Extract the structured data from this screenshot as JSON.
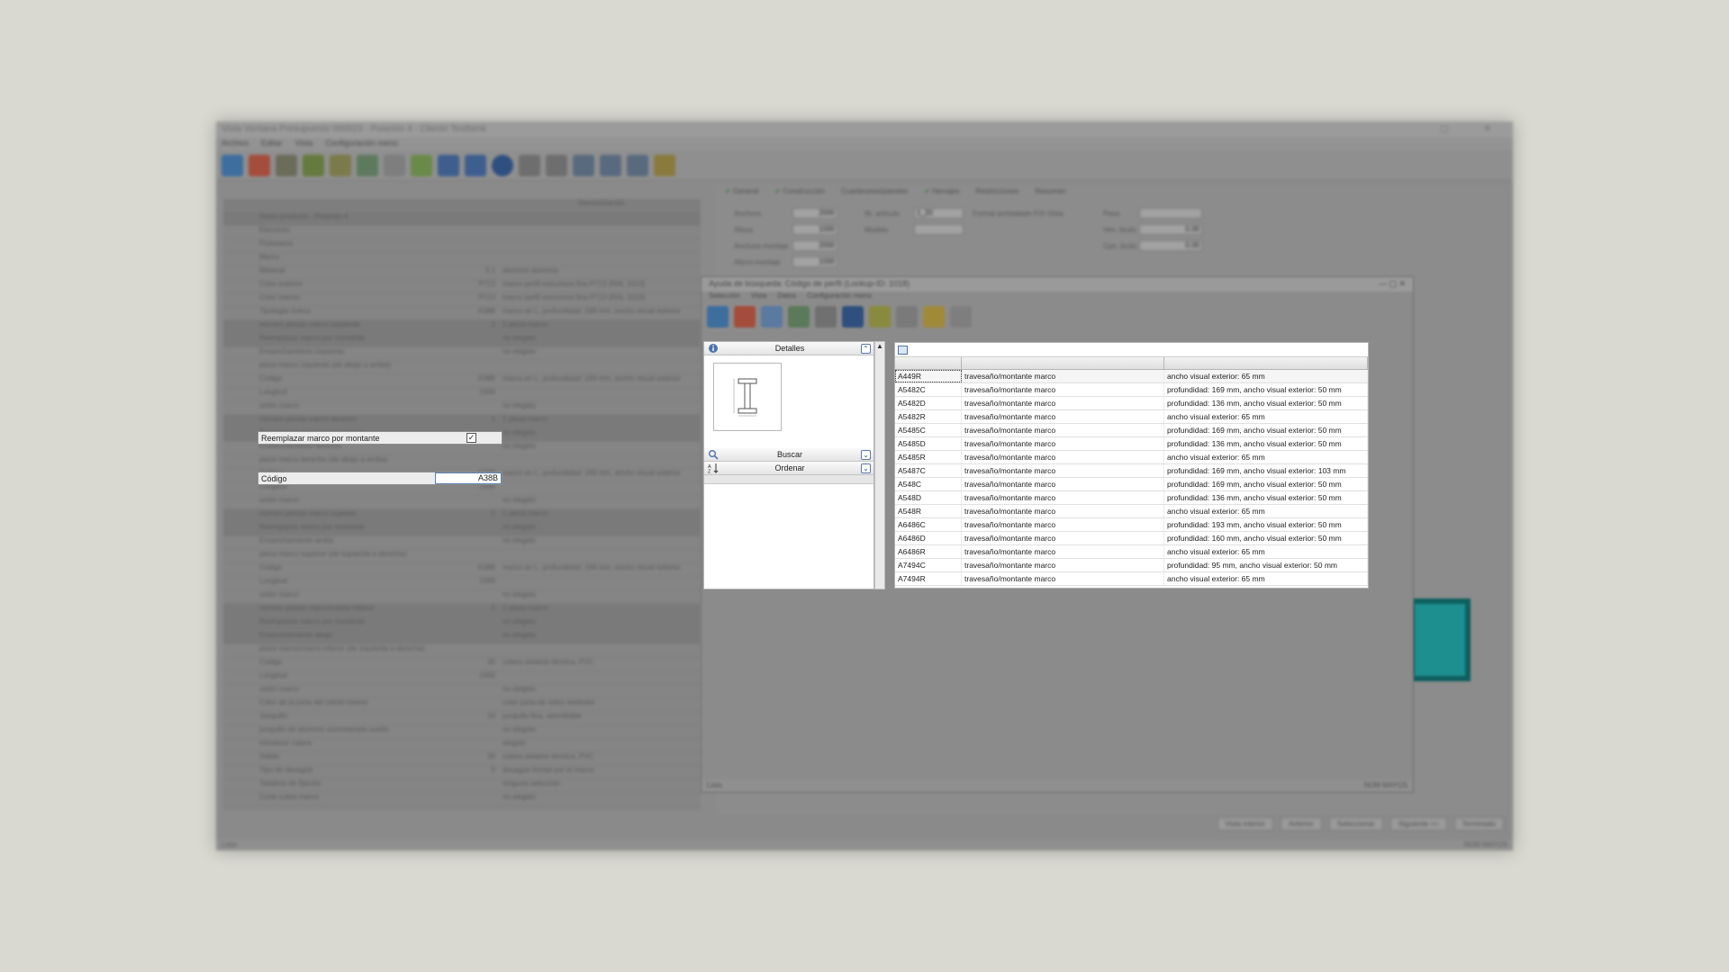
{
  "background_window": {
    "title": "Vista Ventana Presupuesto 000023 - Posición 4 - Cliente Testbenk",
    "window_controls": "▢ ✕",
    "menu": [
      "Archivo",
      "Editar",
      "Vista",
      "Configuración menú"
    ],
    "tree_rows": [
      {
        "label": "Datos producto - Posición 4",
        "value": "",
        "desc": "",
        "dark": true
      },
      {
        "label": "Elemento",
        "value": "",
        "desc": ""
      },
      {
        "label": "Postsasno",
        "value": "",
        "desc": ""
      },
      {
        "label": "Marco",
        "value": "",
        "desc": ""
      },
      {
        "label": "Material",
        "value": "3 1",
        "desc": "aluminio aluminio"
      },
      {
        "label": "Color exterior",
        "value": "P713",
        "desc": "marco perfil estructura fina P713 (RAL 1013)"
      },
      {
        "label": "Color interior",
        "value": "P713",
        "desc": "marco perfil estructura fina P713 (RAL 1013)"
      },
      {
        "label": "Tipología marco",
        "value": "A38B",
        "desc": "marco en L, profundidad: 169 mm, ancho visual exterior"
      },
      {
        "label": "número piezas marco izquierda",
        "value": "1",
        "desc": "1 pieza marco",
        "dark": true
      },
      {
        "label": "Reemplazar marco por montante",
        "value": "",
        "desc": "no elegido",
        "dark": true
      },
      {
        "label": "Ensanchamiento izquierdo",
        "value": "",
        "desc": "no elegido"
      },
      {
        "label": "pieza marco izquierdo (de abajo a arriba)",
        "value": "",
        "desc": ""
      },
      {
        "label": "Código",
        "value": "A38B",
        "desc": "marco en L, profundidad: 169 mm, ancho visual exterior"
      },
      {
        "label": "Longitud",
        "value": "1000",
        "desc": ""
      },
      {
        "label": "unión marco",
        "value": "",
        "desc": "no elegido"
      },
      {
        "label": "número piezas marco derecho",
        "value": "1",
        "desc": "1 pieza marco",
        "dark": true
      },
      {
        "label": "Reemplazar marco por montante",
        "value": "",
        "desc": "no elegido",
        "dark": true
      },
      {
        "label": "Ensanchamiento derecho",
        "value": "",
        "desc": "no elegido"
      },
      {
        "label": "pieza marco derecho (de abajo a arriba)",
        "value": "",
        "desc": ""
      },
      {
        "label": "Código",
        "value": "A38B",
        "desc": "marco en L, profundidad: 169 mm, ancho visual exterior"
      },
      {
        "label": "Longitud",
        "value": "1000",
        "desc": ""
      },
      {
        "label": "unión marco",
        "value": "",
        "desc": "no elegido"
      },
      {
        "label": "número piezas marco superior",
        "value": "1",
        "desc": "1 pieza marco",
        "dark": true
      },
      {
        "label": "Reemplazar marco por montante",
        "value": "",
        "desc": "no elegido",
        "dark": true
      },
      {
        "label": "Ensanchamiento arriba",
        "value": "",
        "desc": "no elegido"
      },
      {
        "label": "pieza marco superior (de izquierda a derecha)",
        "value": "",
        "desc": ""
      },
      {
        "label": "Código",
        "value": "A38B",
        "desc": "marco en L, profundidad: 169 mm, ancho visual exterior"
      },
      {
        "label": "Longitud",
        "value": "1000",
        "desc": ""
      },
      {
        "label": "unión marco",
        "value": "",
        "desc": "no elegido"
      },
      {
        "label": "número piezas marco/cotera inferior",
        "value": "1",
        "desc": "1 pieza marco",
        "dark": true
      },
      {
        "label": "Reemplazar marco por montante",
        "value": "",
        "desc": "no elegido",
        "dark": true
      },
      {
        "label": "Ensanchamiento abajo",
        "value": "",
        "desc": "no elegido",
        "dark": true
      },
      {
        "label": "pieza marco/cotera inferior (de izquierda a derecha)",
        "value": "",
        "desc": ""
      },
      {
        "label": "Código",
        "value": "30",
        "desc": "cotera aislante térmica, PVC"
      },
      {
        "label": "Longitud",
        "value": "1000",
        "desc": ""
      },
      {
        "label": "unión marco",
        "value": "",
        "desc": "no elegido"
      },
      {
        "label": "Color de la junta del vidrial interior",
        "value": "",
        "desc": "color junta de vidrio estándar"
      },
      {
        "label": "Junquillo",
        "value": "10",
        "desc": "junquillo fina, atornillable"
      },
      {
        "label": "junquillo de aluminio suministrado suelto",
        "value": "",
        "desc": "no elegido"
      },
      {
        "label": "Introducir cotera",
        "value": "",
        "desc": "elegido"
      },
      {
        "label": "Sólido",
        "value": "30",
        "desc": "cotera aislante térmica, PVC"
      },
      {
        "label": "Tipo de desagüe",
        "value": "0",
        "desc": "desagüe frontal por el marco"
      },
      {
        "label": "Taladros de fijación",
        "value": "",
        "desc": "ninguna selección"
      },
      {
        "label": "Corte cubre marco",
        "value": "",
        "desc": "no elegido"
      }
    ],
    "column_header": "Denominación",
    "tabs": [
      "General",
      "Construcción",
      "Cuarterones/paneles",
      "Herrajes",
      "Restricciones",
      "Resumen"
    ],
    "fields": {
      "anchura_label": "Anchura",
      "anchura": "2000",
      "altura_label": "Altura",
      "altura": "1000",
      "anchura_montaje_label": "Anchura montaje",
      "anchura_montaje": "2000",
      "altura_montaje_label": "Altura montaje",
      "altura_montaje": "1000",
      "articulo_label": "Nr. artículo",
      "articulo": "1_20",
      "modelo_label": "Modelo",
      "desc_label": "Formal acristalado FIX-Vista",
      "peso_label": "Peso",
      "ven_bruto_label": "Ven. bruto",
      "ven_bruto": "0.00",
      "cpn_bruto_label": "Cpn. bruto",
      "cpn_bruto": "0.00"
    },
    "bottom_buttons": [
      "Vista interior",
      "Anterior",
      "Seleccionar",
      "Siguiente >>",
      "Terminado"
    ],
    "status_left": "Listo",
    "status_right": "NÚM   MAYÚS"
  },
  "overlay_rows": {
    "replace_label": "Reemplazar marco por montante",
    "replace_checked": "✓",
    "code_label": "Código",
    "code_value": "A38B"
  },
  "dialog": {
    "title": "Ayuda de búsqueda: Código de perfil (Lookup-ID: 1018)",
    "window_controls": "—  ▢  ✕",
    "menu": [
      "Selección",
      "Vista",
      "Datos",
      "Configuración menú"
    ],
    "status_left": "Listo",
    "status_right": "NÚM   MAYÚS",
    "panel": {
      "detalles": "Detalles",
      "buscar": "Buscar",
      "ordenar": "Ordenar",
      "scroll_up": "▲",
      "expand": "⌃",
      "collapse": "⌄"
    },
    "grid_rows": [
      {
        "code": "A449R",
        "type": "travesaño/montante marco",
        "desc": "ancho visual exterior: 65 mm"
      },
      {
        "code": "A5482C",
        "type": "travesaño/montante marco",
        "desc": "profundidad: 169 mm, ancho visual exterior: 50 mm"
      },
      {
        "code": "A5482D",
        "type": "travesaño/montante marco",
        "desc": "profundidad: 136 mm, ancho visual exterior: 50 mm"
      },
      {
        "code": "A5482R",
        "type": "travesaño/montante marco",
        "desc": "ancho visual exterior: 65 mm"
      },
      {
        "code": "A5485C",
        "type": "travesaño/montante marco",
        "desc": "profundidad: 169 mm, ancho visual exterior: 50 mm"
      },
      {
        "code": "A5485D",
        "type": "travesaño/montante marco",
        "desc": "profundidad: 136 mm, ancho visual exterior: 50 mm"
      },
      {
        "code": "A5485R",
        "type": "travesaño/montante marco",
        "desc": "ancho visual exterior: 65 mm"
      },
      {
        "code": "A5487C",
        "type": "travesaño/montante marco",
        "desc": "profundidad: 169 mm, ancho visual exterior: 103 mm"
      },
      {
        "code": "A548C",
        "type": "travesaño/montante marco",
        "desc": "profundidad: 169 mm, ancho visual exterior: 50 mm"
      },
      {
        "code": "A548D",
        "type": "travesaño/montante marco",
        "desc": "profundidad: 136 mm, ancho visual exterior: 50 mm"
      },
      {
        "code": "A548R",
        "type": "travesaño/montante marco",
        "desc": "ancho visual exterior: 65 mm"
      },
      {
        "code": "A6486C",
        "type": "travesaño/montante marco",
        "desc": "profundidad: 193 mm, ancho visual exterior: 50 mm"
      },
      {
        "code": "A6486D",
        "type": "travesaño/montante marco",
        "desc": "profundidad: 160 mm, ancho visual exterior: 50 mm"
      },
      {
        "code": "A6486R",
        "type": "travesaño/montante marco",
        "desc": "ancho visual exterior: 65 mm"
      },
      {
        "code": "A7494C",
        "type": "travesaño/montante marco",
        "desc": "profundidad: 95 mm, ancho visual exterior: 50 mm"
      },
      {
        "code": "A7494R",
        "type": "travesaño/montante marco",
        "desc": "ancho visual exterior: 65 mm"
      }
    ]
  },
  "colors": {
    "accent_blue": "#4d74aa",
    "preview_glass": "#1d8f8f"
  }
}
